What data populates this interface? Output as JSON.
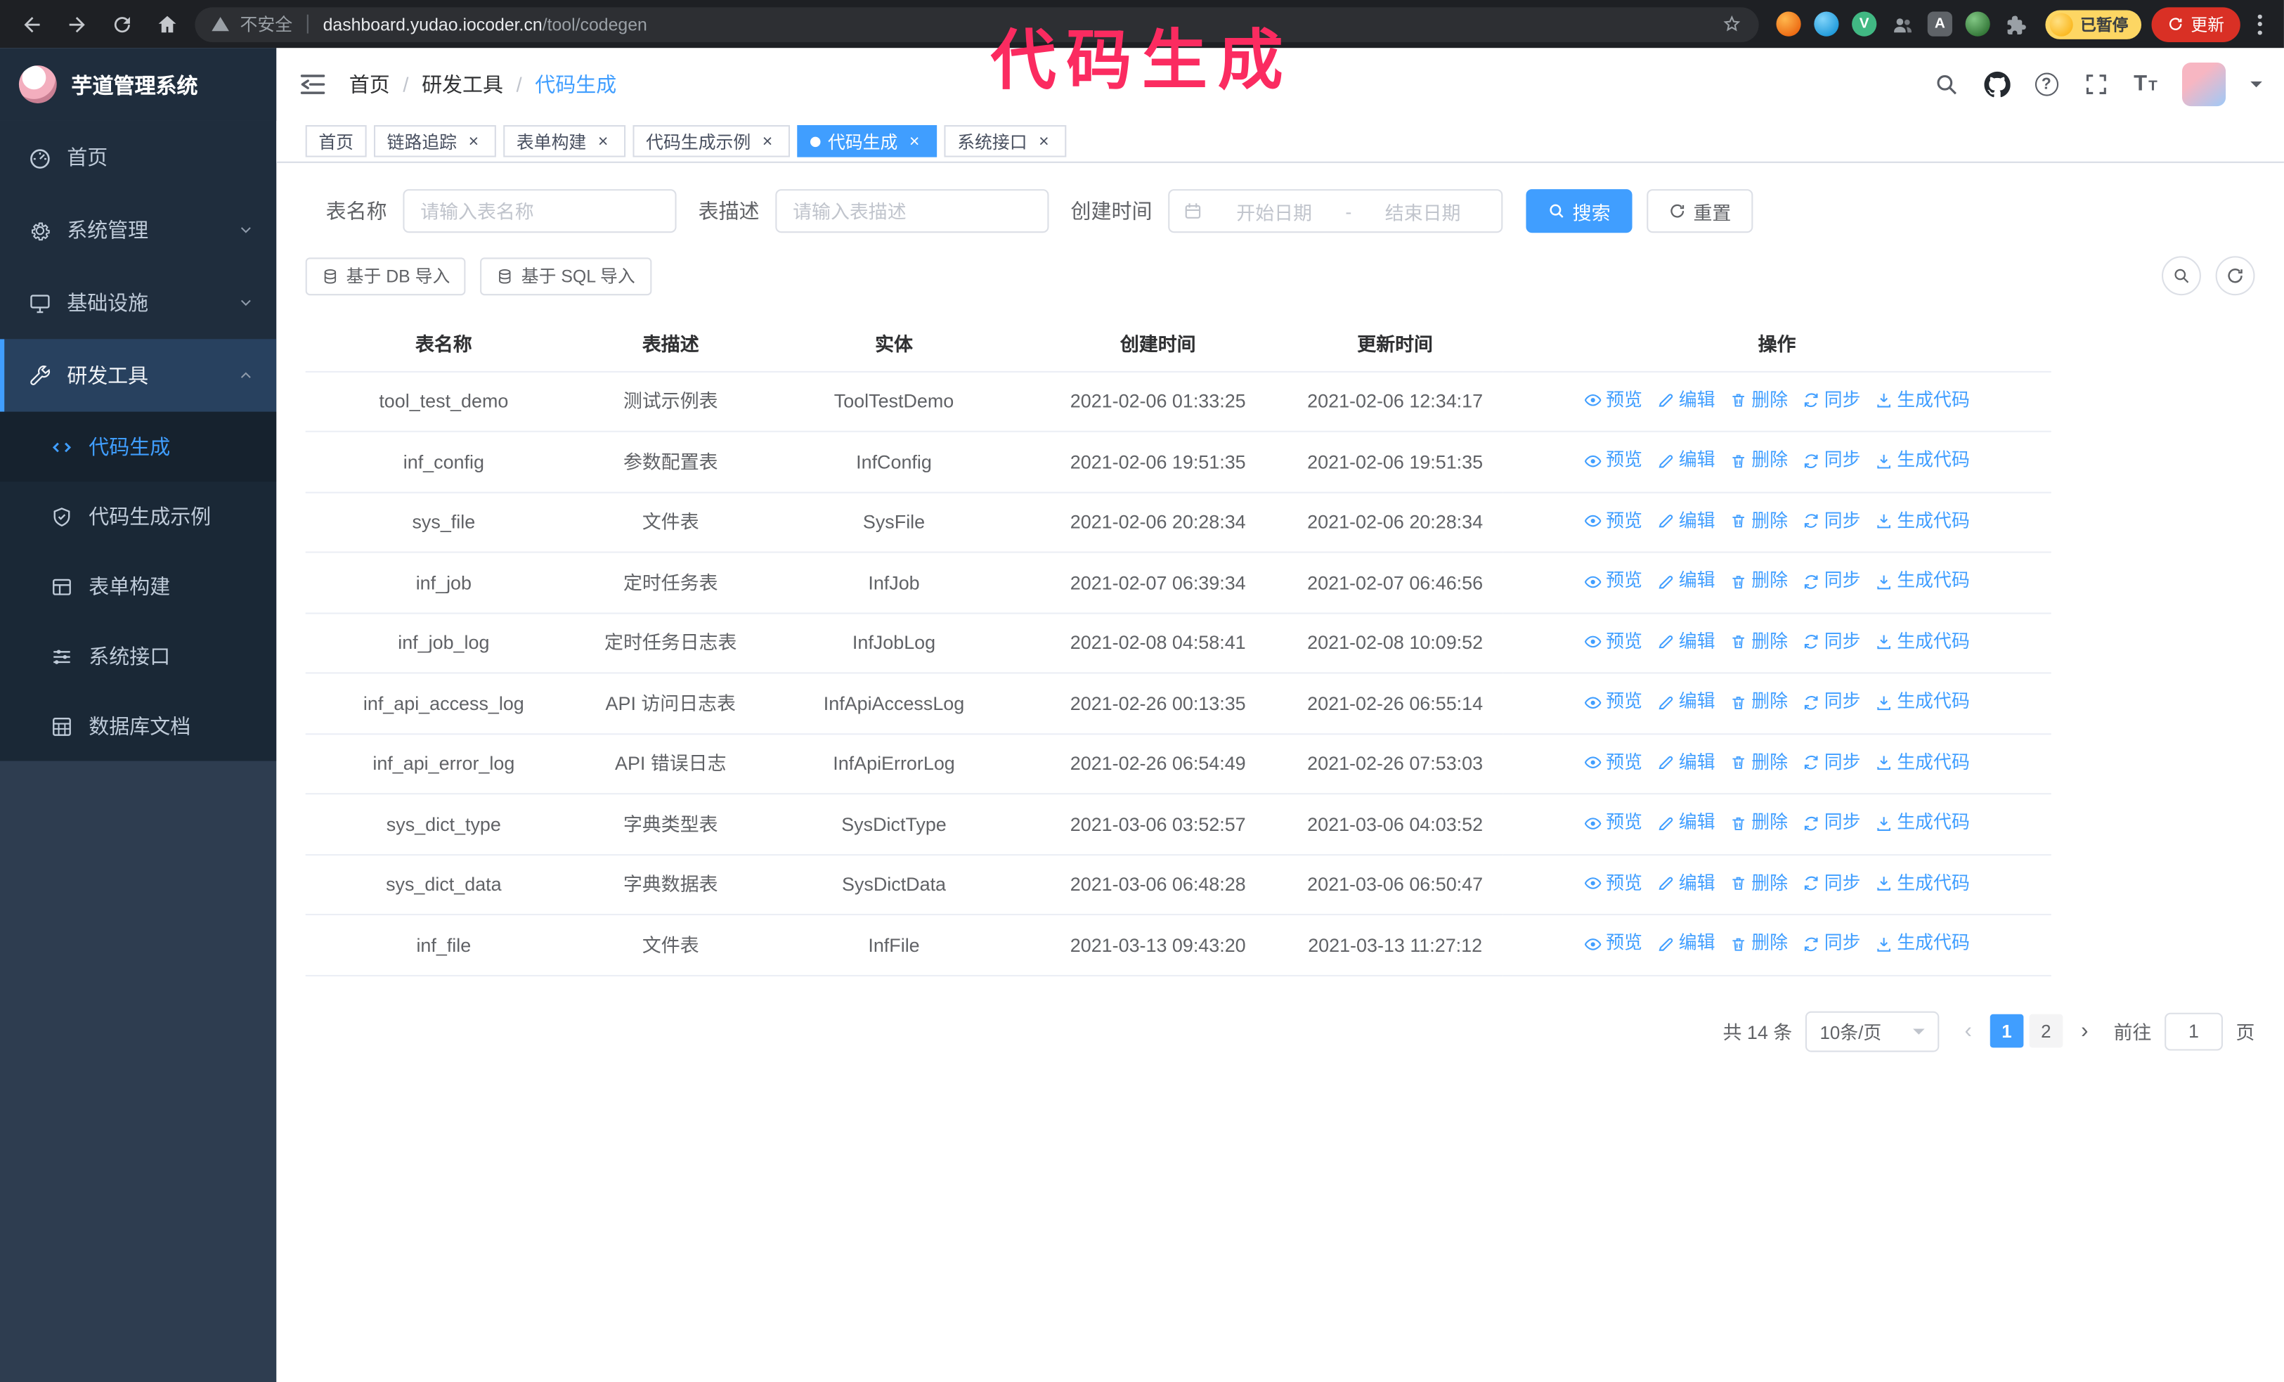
{
  "browser": {
    "security_text": "不安全",
    "url_domain": "dashboard.yudao.iocoder.cn",
    "url_path": "/tool/codegen",
    "profile_badge": "已暂停",
    "update_button": "更新"
  },
  "annotation": {
    "text": "代码生成",
    "color": "#fb2b60"
  },
  "sidebar": {
    "logo_title": "芋道管理系统",
    "menu": [
      {
        "label": "首页",
        "icon": "dashboard-icon"
      },
      {
        "label": "系统管理",
        "icon": "gear-icon",
        "expandable": true
      },
      {
        "label": "基础设施",
        "icon": "infrastructure-icon",
        "expandable": true
      },
      {
        "label": "研发工具",
        "icon": "tools-icon",
        "expandable": true,
        "expanded": true,
        "active": true
      }
    ],
    "submenu": [
      {
        "label": "代码生成",
        "icon": "code-icon",
        "active": true
      },
      {
        "label": "代码生成示例",
        "icon": "example-shield-icon"
      },
      {
        "label": "表单构建",
        "icon": "form-build-icon"
      },
      {
        "label": "系统接口",
        "icon": "api-sliders-icon"
      },
      {
        "label": "数据库文档",
        "icon": "db-doc-icon"
      }
    ]
  },
  "header": {
    "breadcrumb": [
      "首页",
      "研发工具",
      "代码生成"
    ]
  },
  "tabs": [
    {
      "key": "home",
      "label": "首页",
      "closable": false,
      "active": false
    },
    {
      "key": "tracing",
      "label": "链路追踪",
      "closable": true,
      "active": false
    },
    {
      "key": "form-builder",
      "label": "表单构建",
      "closable": true,
      "active": false
    },
    {
      "key": "codegen-example",
      "label": "代码生成示例",
      "closable": true,
      "active": false
    },
    {
      "key": "codegen",
      "label": "代码生成",
      "closable": true,
      "active": true
    },
    {
      "key": "system-api",
      "label": "系统接口",
      "closable": true,
      "active": false
    }
  ],
  "filters": {
    "table_name_label": "表名称",
    "table_name_placeholder": "请输入表名称",
    "table_desc_label": "表描述",
    "table_desc_placeholder": "请输入表描述",
    "create_time_label": "创建时间",
    "start_placeholder": "开始日期",
    "range_separator": "-",
    "end_placeholder": "结束日期",
    "search_button": "搜索",
    "reset_button": "重置"
  },
  "toolbar": {
    "import_db_label": "基于 DB 导入",
    "import_sql_label": "基于 SQL 导入"
  },
  "table": {
    "columns": [
      "表名称",
      "表描述",
      "实体",
      "创建时间",
      "更新时间",
      "操作"
    ],
    "actions": [
      {
        "key": "preview",
        "label": "预览",
        "icon": "eye-icon"
      },
      {
        "key": "edit",
        "label": "编辑",
        "icon": "edit-icon"
      },
      {
        "key": "delete",
        "label": "删除",
        "icon": "trash-icon"
      },
      {
        "key": "sync",
        "label": "同步",
        "icon": "sync-icon"
      },
      {
        "key": "generate",
        "label": "生成代码",
        "icon": "download-icon"
      }
    ],
    "rows": [
      {
        "name": "tool_test_demo",
        "desc": "测试示例表",
        "entity": "ToolTestDemo",
        "created": "2021-02-06 01:33:25",
        "updated": "2021-02-06 12:34:17"
      },
      {
        "name": "inf_config",
        "desc": "参数配置表",
        "entity": "InfConfig",
        "created": "2021-02-06 19:51:35",
        "updated": "2021-02-06 19:51:35"
      },
      {
        "name": "sys_file",
        "desc": "文件表",
        "entity": "SysFile",
        "created": "2021-02-06 20:28:34",
        "updated": "2021-02-06 20:28:34"
      },
      {
        "name": "inf_job",
        "desc": "定时任务表",
        "entity": "InfJob",
        "created": "2021-02-07 06:39:34",
        "updated": "2021-02-07 06:46:56"
      },
      {
        "name": "inf_job_log",
        "desc": "定时任务日志表",
        "entity": "InfJobLog",
        "created": "2021-02-08 04:58:41",
        "updated": "2021-02-08 10:09:52"
      },
      {
        "name": "inf_api_access_log",
        "desc": "API 访问日志表",
        "entity": "InfApiAccessLog",
        "created": "2021-02-26 00:13:35",
        "updated": "2021-02-26 06:55:14"
      },
      {
        "name": "inf_api_error_log",
        "desc": "API 错误日志",
        "entity": "InfApiErrorLog",
        "created": "2021-02-26 06:54:49",
        "updated": "2021-02-26 07:53:03"
      },
      {
        "name": "sys_dict_type",
        "desc": "字典类型表",
        "entity": "SysDictType",
        "created": "2021-03-06 03:52:57",
        "updated": "2021-03-06 04:03:52"
      },
      {
        "name": "sys_dict_data",
        "desc": "字典数据表",
        "entity": "SysDictData",
        "created": "2021-03-06 06:48:28",
        "updated": "2021-03-06 06:50:47"
      },
      {
        "name": "inf_file",
        "desc": "文件表",
        "entity": "InfFile",
        "created": "2021-03-13 09:43:20",
        "updated": "2021-03-13 11:27:12"
      }
    ]
  },
  "pagination": {
    "total_text": "共 14 条",
    "page_size_text": "10条/页",
    "pages": [
      "1",
      "2"
    ],
    "active_page": "1",
    "goto_text": "前往",
    "goto_value": "1",
    "goto_suffix": "页"
  },
  "colors": {
    "accent": "#409eff",
    "sidebar_bg": "#1f2d3d",
    "annotation_pink": "#fb2b60",
    "paused_badge_yellow": "#fdd663",
    "update_button_red": "#d93025",
    "link_blue": "#409eff"
  },
  "icons_legend": {
    "back-icon": "left arrow",
    "forward-icon": "right arrow",
    "reload-icon": "circular arrow",
    "home-icon": "house",
    "warning-icon": "triangle !",
    "bookmark-star-icon": "star outline",
    "extensions-puzzle-icon": "puzzle piece",
    "menu-dots-icon": "vertical ellipsis",
    "search-icon": "magnifier",
    "github-icon": "octocat",
    "help-icon": "? circle",
    "fullscreen-icon": "corner brackets",
    "font-size-icon": "T T",
    "calendar-icon": "calendar",
    "database-icon": "db cylinder",
    "refresh-icon": "circular arrow",
    "eye-icon": "eye",
    "edit-icon": "pencil",
    "trash-icon": "trash can",
    "sync-icon": "two arrows",
    "download-icon": "down arrow tray",
    "close-icon": "×"
  }
}
